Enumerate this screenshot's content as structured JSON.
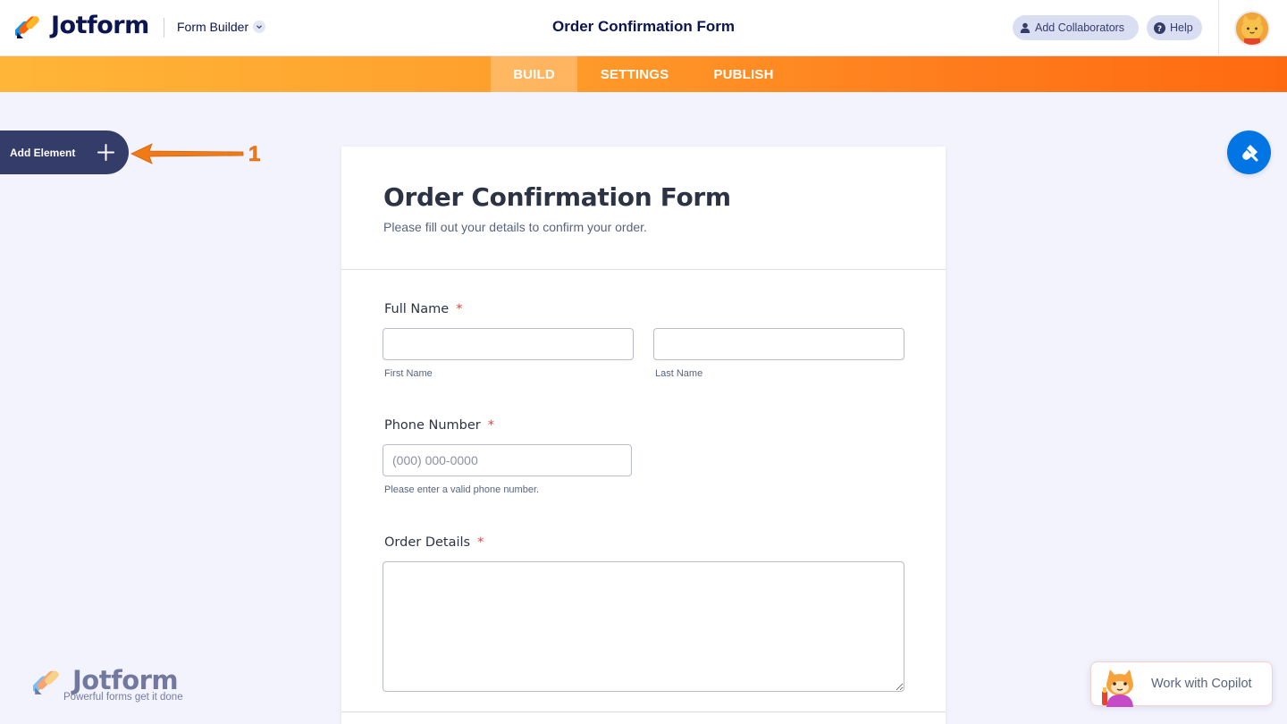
{
  "header": {
    "brand": "Jotform",
    "builder_menu": "Form Builder",
    "form_title": "Order Confirmation Form",
    "add_collaborators": "Add Collaborators",
    "help": "Help"
  },
  "nav": {
    "tabs": [
      {
        "label": "BUILD",
        "active": true
      },
      {
        "label": "SETTINGS",
        "active": false
      },
      {
        "label": "PUBLISH",
        "active": false
      }
    ]
  },
  "sidebar": {
    "add_element": "Add Element",
    "annotation_number": "1"
  },
  "form": {
    "title": "Order Confirmation Form",
    "subtitle": "Please fill out your details to confirm your order.",
    "fields": {
      "full_name": {
        "label": "Full Name",
        "required_mark": "*",
        "first_sublabel": "First Name",
        "last_sublabel": "Last Name",
        "first_value": "",
        "last_value": ""
      },
      "phone": {
        "label": "Phone Number",
        "required_mark": "*",
        "placeholder": "(000) 000-0000",
        "value": "",
        "sublabel": "Please enter a valid phone number."
      },
      "order_details": {
        "label": "Order Details",
        "required_mark": "*",
        "value": ""
      }
    }
  },
  "watermark": {
    "brand": "Jotform",
    "tagline": "Powerful forms get it done"
  },
  "copilot": {
    "label": "Work with Copilot"
  },
  "colors": {
    "nav_gradient_start": "#ffb638",
    "nav_gradient_end": "#ff6a10",
    "brand_navy": "#0a1551",
    "add_element_bg": "#343c6a",
    "paint_button": "#0075e3",
    "required": "#f23a3c",
    "arrow": "#f07a16"
  },
  "icons": {
    "logo": "jotform-logo-icon",
    "chevron": "chevron-down-icon",
    "collaborator": "user-icon",
    "help": "question-circle-icon",
    "avatar": "cat-avatar-icon",
    "plus": "plus-icon",
    "paint": "paint-brush-icon",
    "copilot": "cat-mascot-icon"
  }
}
